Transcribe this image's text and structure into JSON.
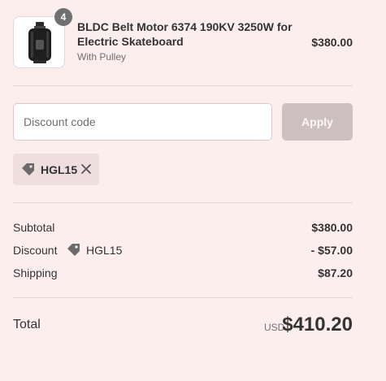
{
  "product": {
    "quantity": "4",
    "title": "BLDC Belt Motor 6374 190KV 3250W for Electric Skateboard",
    "variant": "With Pulley",
    "price": "$380.00",
    "image_icon": "motor-image"
  },
  "discount": {
    "placeholder": "Discount code",
    "apply_label": "Apply",
    "applied_code": "HGL15"
  },
  "summary": {
    "subtotal_label": "Subtotal",
    "subtotal_value": "$380.00",
    "discount_label": "Discount",
    "discount_code": "HGL15",
    "discount_value": "- $57.00",
    "shipping_label": "Shipping",
    "shipping_value": "$87.20"
  },
  "total": {
    "label": "Total",
    "currency": "USD",
    "value": "$410.20"
  },
  "colors": {
    "background": "#fdeeee",
    "button_disabled": "#cebfc0",
    "chip": "#eedede",
    "badge": "#707070"
  }
}
